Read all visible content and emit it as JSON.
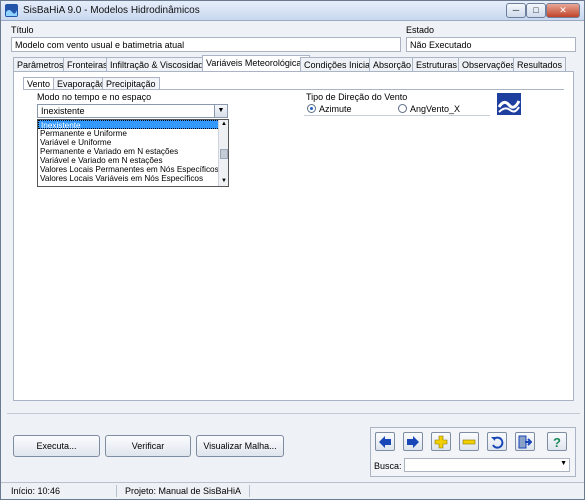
{
  "window": {
    "title": "SisBaHiA 9.0 - Modelos Hidrodinâmicos",
    "min_label": "─",
    "max_label": "□",
    "close_label": "✕"
  },
  "header": {
    "titulo_label": "Título",
    "titulo_value": "Modelo com vento usual e batimetria atual",
    "estado_label": "Estado",
    "estado_value": "Não Executado"
  },
  "tabs": [
    {
      "label": "Parâmetros"
    },
    {
      "label": "Fronteiras"
    },
    {
      "label": "Infiltração & Viscosidade"
    },
    {
      "label": "Variáveis Meteorológicas"
    },
    {
      "label": "Condições Iniciais"
    },
    {
      "label": "Absorção"
    },
    {
      "label": "Estruturas"
    },
    {
      "label": "Observações"
    },
    {
      "label": "Resultados"
    }
  ],
  "subtabs": [
    {
      "label": "Vento"
    },
    {
      "label": "Evaporação"
    },
    {
      "label": "Precipitação"
    }
  ],
  "modo": {
    "label": "Modo no tempo e no espaço",
    "selected": "Inexistente",
    "options": [
      "Inexistente",
      "Permanente e Uniforme",
      "Variável e Uniforme",
      "Permanente e Variado em N estações",
      "Variável e Variado em N estações",
      "Valores Locais Permanentes em Nós Específicos",
      "Valores Locais Variáveis em Nós Específicos"
    ]
  },
  "direcao": {
    "label": "Tipo de Direção do Vento",
    "opt1": "Azimute",
    "opt2": "AngVento_X",
    "selected": "Azimute"
  },
  "buttons": {
    "executa": "Executa...",
    "verificar": "Verificar",
    "visualizar": "Visualizar Malha..."
  },
  "nav": {
    "icons": [
      "arrow-left-icon",
      "arrow-right-icon",
      "plus-icon",
      "minus-icon",
      "undo-icon",
      "exit-icon",
      "help-icon"
    ],
    "busca_label": "Busca:",
    "busca_value": ""
  },
  "status": {
    "inicio": "Início: 10:46",
    "projeto": "Projeto: Manual de SisBaHiA"
  },
  "colors": {
    "accent": "#3399ff",
    "nav_arrow": "#1a47b8",
    "nav_plusminus": "#f2d000"
  }
}
